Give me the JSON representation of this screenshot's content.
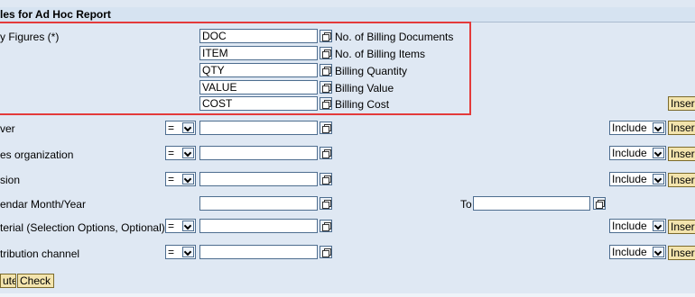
{
  "header": {
    "title": "les for Ad Hoc Report"
  },
  "key_figures": {
    "label": "y Figures (*)",
    "rows": [
      {
        "value": "DOC",
        "description": "No. of Billing Documents"
      },
      {
        "value": "ITEM",
        "description": "No. of Billing Items"
      },
      {
        "value": "QTY",
        "description": "Billing Quantity"
      },
      {
        "value": "VALUE",
        "description": "Billing Value"
      },
      {
        "value": "COST",
        "description": "Billing Cost"
      }
    ],
    "insert_label": "Inser"
  },
  "criteria": [
    {
      "label": "ver",
      "operator": "=",
      "value": "",
      "include": "Include",
      "insert_label": "Inser"
    },
    {
      "label": "es organization",
      "operator": "=",
      "value": "",
      "include": "Include",
      "insert_label": "Inser"
    },
    {
      "label": "sion",
      "operator": "=",
      "value": "",
      "include": "Include",
      "insert_label": "Inser"
    },
    {
      "label": "endar Month/Year",
      "value": "",
      "to_label": "To",
      "to_value": ""
    },
    {
      "label": "terial (Selection Options, Optional)",
      "operator": "=",
      "value": "",
      "include": "Include",
      "insert_label": "Inser"
    },
    {
      "label": "tribution channel",
      "operator": "=",
      "value": "",
      "include": "Include",
      "insert_label": "Inser"
    }
  ],
  "footer": {
    "execute_label": "ute",
    "check_label": "Check"
  },
  "colors": {
    "highlight": "#e43a3a",
    "button_bg": "#f3e4ad",
    "background": "#dfe8f3"
  }
}
